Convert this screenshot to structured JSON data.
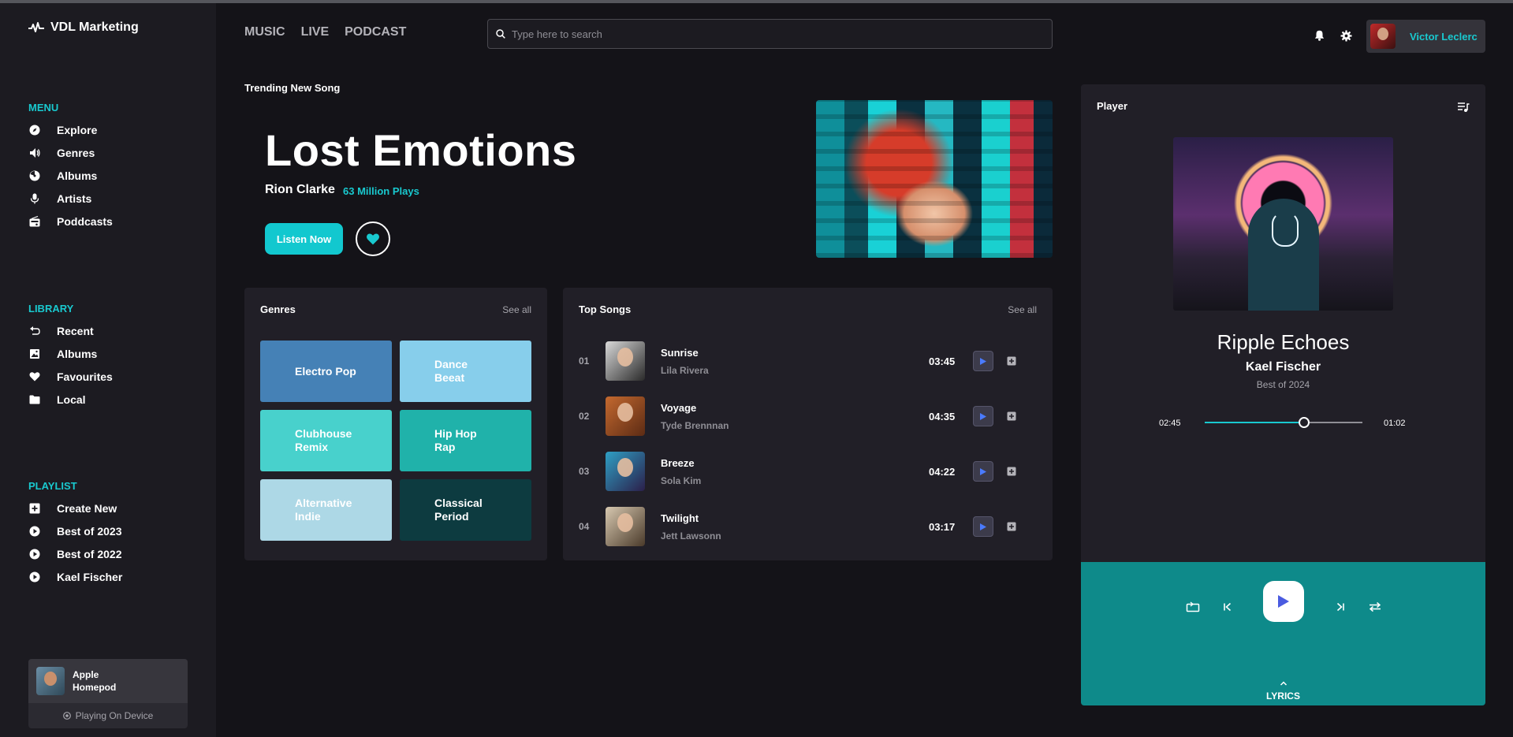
{
  "app": {
    "brand": "VDL Marketing"
  },
  "sidebar": {
    "menu_title": "MENU",
    "menu": [
      {
        "label": "Explore",
        "icon": "compass-icon"
      },
      {
        "label": "Genres",
        "icon": "speaker-icon"
      },
      {
        "label": "Albums",
        "icon": "album-icon"
      },
      {
        "label": "Artists",
        "icon": "microphone-icon"
      },
      {
        "label": "Poddcasts",
        "icon": "radio-icon"
      }
    ],
    "library_title": "LIBRARY",
    "library": [
      {
        "label": "Recent",
        "icon": "undo-icon"
      },
      {
        "label": "Albums",
        "icon": "image-icon"
      },
      {
        "label": "Favourites",
        "icon": "heart-icon"
      },
      {
        "label": "Local",
        "icon": "folder-icon"
      }
    ],
    "playlist_title": "PLAYLIST",
    "playlist": [
      {
        "label": "Create New",
        "icon": "plus-square-icon"
      },
      {
        "label": "Best of 2023",
        "icon": "play-circle-icon"
      },
      {
        "label": "Best of 2022",
        "icon": "play-circle-icon"
      },
      {
        "label": "Kael Fischer",
        "icon": "play-circle-icon"
      }
    ],
    "device": {
      "name": "Apple Homepod",
      "status": "Playing On Device"
    }
  },
  "header": {
    "nav": [
      "MUSIC",
      "LIVE",
      "PODCAST"
    ],
    "search_placeholder": "Type here to search",
    "user": "Victor Leclerc"
  },
  "hero": {
    "label": "Trending New Song",
    "title": "Lost Emotions",
    "artist": "Rion Clarke",
    "plays": "63 Million Plays",
    "listen_label": "Listen Now"
  },
  "genres": {
    "title": "Genres",
    "see_all": "See all",
    "items": [
      {
        "label": "Electro Pop",
        "color": "#4581b6"
      },
      {
        "label": "Dance Beeat",
        "color": "#87ceeb"
      },
      {
        "label": "Clubhouse Remix",
        "color": "#48d1cc"
      },
      {
        "label": "Hip Hop Rap",
        "color": "#20b2aa"
      },
      {
        "label": "Alternative Indie",
        "color": "#add8e6"
      },
      {
        "label": "Classical Period",
        "color": "#0d3b40"
      }
    ]
  },
  "top_songs": {
    "title": "Top Songs",
    "see_all": "See all",
    "items": [
      {
        "num": "01",
        "title": "Sunrise",
        "artist": "Lila Rivera",
        "duration": "03:45"
      },
      {
        "num": "02",
        "title": "Voyage",
        "artist": "Tyde Brennnan",
        "duration": "04:35"
      },
      {
        "num": "03",
        "title": "Breeze",
        "artist": "Sola Kim",
        "duration": "04:22"
      },
      {
        "num": "04",
        "title": "Twilight",
        "artist": "Jett Lawsonn",
        "duration": "03:17"
      }
    ]
  },
  "player": {
    "label": "Player",
    "title": "Ripple Echoes",
    "artist": "Kael Fischer",
    "album": "Best of 2024",
    "elapsed": "02:45",
    "remaining": "01:02",
    "progress": 0.63,
    "lyrics_label": "LYRICS"
  },
  "colors": {
    "accent": "#19c9cf",
    "control_bg": "#0e8a8a",
    "play_icon": "#4a5be0"
  }
}
